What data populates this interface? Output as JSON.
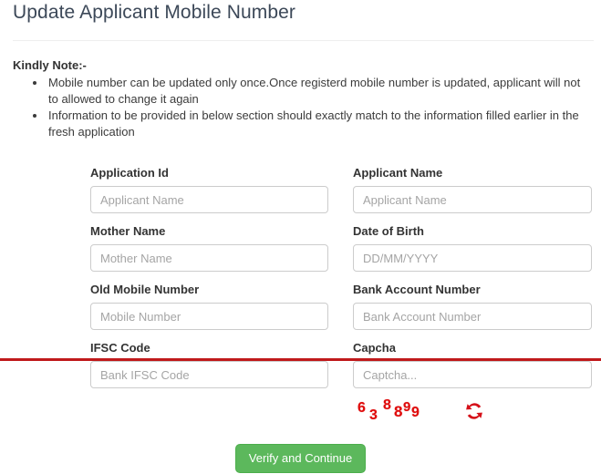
{
  "header": {
    "title": "Update Applicant Mobile Number"
  },
  "notes": {
    "heading": "Kindly Note:-",
    "items": [
      "Mobile number can be updated only once.Once registerd mobile number is updated, applicant will not to allowed to change it again",
      "Information to be provided in below section should exactly match to the information filled earlier in the fresh application"
    ]
  },
  "form": {
    "fields": [
      {
        "label": "Application Id",
        "placeholder": "Applicant Name",
        "value": ""
      },
      {
        "label": "Applicant Name",
        "placeholder": "Applicant Name",
        "value": ""
      },
      {
        "label": "Mother Name",
        "placeholder": "Mother Name",
        "value": ""
      },
      {
        "label": "Date of Birth",
        "placeholder": "DD/MM/YYYY",
        "value": ""
      },
      {
        "label": "Old Mobile Number",
        "placeholder": "Mobile Number",
        "value": ""
      },
      {
        "label": "Bank Account Number",
        "placeholder": "Bank Account Number",
        "value": ""
      },
      {
        "label": "IFSC Code",
        "placeholder": "Bank IFSC Code",
        "value": ""
      },
      {
        "label": "Capcha",
        "placeholder": "Captcha...",
        "value": ""
      }
    ]
  },
  "captcha": {
    "digits": [
      "6",
      "3",
      "8",
      "8",
      "9",
      "9"
    ],
    "text": "638899",
    "refresh_icon": "refresh-icon",
    "color": "#e00b0b"
  },
  "submit": {
    "label": "Verify and Continue",
    "color": "#5cb85c"
  },
  "decorations": {
    "red_rule_color": "#c0191b",
    "divider_color": "#eeeeee"
  }
}
